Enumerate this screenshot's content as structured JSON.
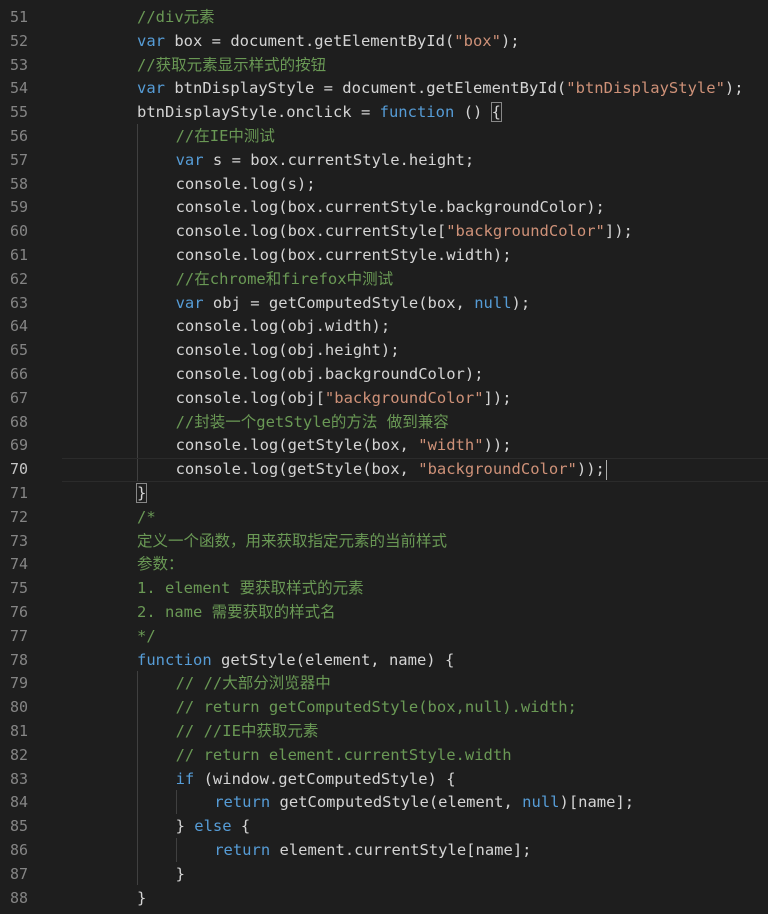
{
  "editor": {
    "lines": [
      {
        "num": "51",
        "indent": 0,
        "tokens": [
          {
            "t": "c",
            "v": "//div元素"
          }
        ]
      },
      {
        "num": "52",
        "indent": 0,
        "tokens": [
          {
            "t": "k",
            "v": "var"
          },
          {
            "t": "p",
            "v": " box = document.getElementById("
          },
          {
            "t": "s",
            "v": "\"box\""
          },
          {
            "t": "p",
            "v": ");"
          }
        ]
      },
      {
        "num": "53",
        "indent": 0,
        "tokens": [
          {
            "t": "c",
            "v": "//获取元素显示样式的按钮"
          }
        ]
      },
      {
        "num": "54",
        "indent": 0,
        "tokens": [
          {
            "t": "k",
            "v": "var"
          },
          {
            "t": "p",
            "v": " btnDisplayStyle = document.getElementById("
          },
          {
            "t": "s",
            "v": "\"btnDisplayStyle\""
          },
          {
            "t": "p",
            "v": ");"
          }
        ]
      },
      {
        "num": "55",
        "indent": 0,
        "tokens": [
          {
            "t": "p",
            "v": "btnDisplayStyle.onclick = "
          },
          {
            "t": "k",
            "v": "function"
          },
          {
            "t": "p",
            "v": " () "
          },
          {
            "t": "b",
            "v": "{"
          }
        ]
      },
      {
        "num": "56",
        "indent": 1,
        "tokens": [
          {
            "t": "c",
            "v": "//在IE中测试"
          }
        ]
      },
      {
        "num": "57",
        "indent": 1,
        "tokens": [
          {
            "t": "k",
            "v": "var"
          },
          {
            "t": "p",
            "v": " s = box.currentStyle.height;"
          }
        ]
      },
      {
        "num": "58",
        "indent": 1,
        "tokens": [
          {
            "t": "p",
            "v": "console.log(s);"
          }
        ]
      },
      {
        "num": "59",
        "indent": 1,
        "tokens": [
          {
            "t": "p",
            "v": "console.log(box.currentStyle.backgroundColor);"
          }
        ]
      },
      {
        "num": "60",
        "indent": 1,
        "tokens": [
          {
            "t": "p",
            "v": "console.log(box.currentStyle["
          },
          {
            "t": "s",
            "v": "\"backgroundColor\""
          },
          {
            "t": "p",
            "v": "]);"
          }
        ]
      },
      {
        "num": "61",
        "indent": 1,
        "tokens": [
          {
            "t": "p",
            "v": "console.log(box.currentStyle.width);"
          }
        ]
      },
      {
        "num": "62",
        "indent": 1,
        "tokens": [
          {
            "t": "c",
            "v": "//在chrome和firefox中测试"
          }
        ]
      },
      {
        "num": "63",
        "indent": 1,
        "tokens": [
          {
            "t": "k",
            "v": "var"
          },
          {
            "t": "p",
            "v": " obj = getComputedStyle(box, "
          },
          {
            "t": "k",
            "v": "null"
          },
          {
            "t": "p",
            "v": ");"
          }
        ]
      },
      {
        "num": "64",
        "indent": 1,
        "tokens": [
          {
            "t": "p",
            "v": "console.log(obj.width);"
          }
        ]
      },
      {
        "num": "65",
        "indent": 1,
        "tokens": [
          {
            "t": "p",
            "v": "console.log(obj.height);"
          }
        ]
      },
      {
        "num": "66",
        "indent": 1,
        "tokens": [
          {
            "t": "p",
            "v": "console.log(obj.backgroundColor);"
          }
        ]
      },
      {
        "num": "67",
        "indent": 1,
        "tokens": [
          {
            "t": "p",
            "v": "console.log(obj["
          },
          {
            "t": "s",
            "v": "\"backgroundColor\""
          },
          {
            "t": "p",
            "v": "]);"
          }
        ]
      },
      {
        "num": "68",
        "indent": 1,
        "tokens": [
          {
            "t": "c",
            "v": "//封装一个getStyle的方法 做到兼容"
          }
        ]
      },
      {
        "num": "69",
        "indent": 1,
        "tokens": [
          {
            "t": "p",
            "v": "console.log(getStyle(box, "
          },
          {
            "t": "s",
            "v": "\"width\""
          },
          {
            "t": "p",
            "v": "));"
          }
        ]
      },
      {
        "num": "70",
        "indent": 1,
        "current": true,
        "tokens": [
          {
            "t": "p",
            "v": "console.log(getStyle(box, "
          },
          {
            "t": "s",
            "v": "\"backgroundColor\""
          },
          {
            "t": "p",
            "v": "));"
          }
        ]
      },
      {
        "num": "71",
        "indent": 0,
        "tokens": [
          {
            "t": "b",
            "v": "}"
          }
        ]
      },
      {
        "num": "72",
        "indent": 0,
        "tokens": [
          {
            "t": "c",
            "v": "/*"
          }
        ]
      },
      {
        "num": "73",
        "indent": 0,
        "tokens": [
          {
            "t": "c",
            "v": "定义一个函数，用来获取指定元素的当前样式"
          }
        ]
      },
      {
        "num": "74",
        "indent": 0,
        "tokens": [
          {
            "t": "c",
            "v": "参数："
          }
        ]
      },
      {
        "num": "75",
        "indent": 0,
        "tokens": [
          {
            "t": "c",
            "v": "1. element 要获取样式的元素"
          }
        ]
      },
      {
        "num": "76",
        "indent": 0,
        "tokens": [
          {
            "t": "c",
            "v": "2. name 需要获取的样式名"
          }
        ]
      },
      {
        "num": "77",
        "indent": 0,
        "tokens": [
          {
            "t": "c",
            "v": "*/"
          }
        ]
      },
      {
        "num": "78",
        "indent": 0,
        "tokens": [
          {
            "t": "k",
            "v": "function"
          },
          {
            "t": "p",
            "v": " getStyle(element, name) {"
          }
        ]
      },
      {
        "num": "79",
        "indent": 1,
        "tokens": [
          {
            "t": "c",
            "v": "// //大部分浏览器中"
          }
        ]
      },
      {
        "num": "80",
        "indent": 1,
        "tokens": [
          {
            "t": "c",
            "v": "// return getComputedStyle(box,null).width;"
          }
        ]
      },
      {
        "num": "81",
        "indent": 1,
        "tokens": [
          {
            "t": "c",
            "v": "// //IE中获取元素"
          }
        ]
      },
      {
        "num": "82",
        "indent": 1,
        "tokens": [
          {
            "t": "c",
            "v": "// return element.currentStyle.width"
          }
        ]
      },
      {
        "num": "83",
        "indent": 1,
        "tokens": [
          {
            "t": "k",
            "v": "if"
          },
          {
            "t": "p",
            "v": " (window.getComputedStyle) {"
          }
        ]
      },
      {
        "num": "84",
        "indent": 2,
        "tokens": [
          {
            "t": "k",
            "v": "return"
          },
          {
            "t": "p",
            "v": " getComputedStyle(element, "
          },
          {
            "t": "k",
            "v": "null"
          },
          {
            "t": "p",
            "v": ")[name];"
          }
        ]
      },
      {
        "num": "85",
        "indent": 1,
        "tokens": [
          {
            "t": "p",
            "v": "} "
          },
          {
            "t": "k",
            "v": "else"
          },
          {
            "t": "p",
            "v": " {"
          }
        ]
      },
      {
        "num": "86",
        "indent": 2,
        "tokens": [
          {
            "t": "k",
            "v": "return"
          },
          {
            "t": "p",
            "v": " element.currentStyle[name];"
          }
        ]
      },
      {
        "num": "87",
        "indent": 1,
        "tokens": [
          {
            "t": "p",
            "v": "}"
          }
        ]
      },
      {
        "num": "88",
        "indent": 0,
        "tokens": [
          {
            "t": "p",
            "v": "}"
          }
        ]
      }
    ],
    "colors": {
      "background": "#1e1e1e",
      "comment": "#6a9955",
      "keyword": "#569cd6",
      "string": "#ce9178",
      "text": "#d4d4d4",
      "line_number": "#858585"
    }
  }
}
